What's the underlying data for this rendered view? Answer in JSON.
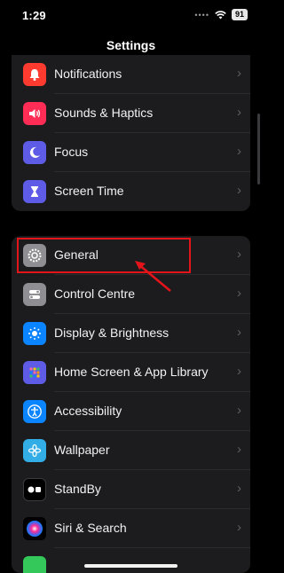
{
  "status": {
    "time": "1:29",
    "battery": "91"
  },
  "header": {
    "title": "Settings"
  },
  "group1": [
    {
      "label": "Notifications",
      "icon": "bell-icon",
      "color": "#ff3b30"
    },
    {
      "label": "Sounds & Haptics",
      "icon": "speaker-icon",
      "color": "#ff2d55"
    },
    {
      "label": "Focus",
      "icon": "moon-icon",
      "color": "#5e5ce6"
    },
    {
      "label": "Screen Time",
      "icon": "hourglass-icon",
      "color": "#5e5ce6"
    }
  ],
  "group2": [
    {
      "label": "General",
      "icon": "gear-icon",
      "color": "#8e8e93"
    },
    {
      "label": "Control Centre",
      "icon": "toggles-icon",
      "color": "#8e8e93"
    },
    {
      "label": "Display & Brightness",
      "icon": "sun-icon",
      "color": "#0a84ff"
    },
    {
      "label": "Home Screen & App Library",
      "icon": "grid-icon",
      "color": "#5e5ce6"
    },
    {
      "label": "Accessibility",
      "icon": "accessibility-icon",
      "color": "#0a84ff"
    },
    {
      "label": "Wallpaper",
      "icon": "flower-icon",
      "color": "#32ade6"
    },
    {
      "label": "StandBy",
      "icon": "standby-icon",
      "color": "#1c1c1e"
    },
    {
      "label": "Siri & Search",
      "icon": "siri-icon",
      "color": "#2c2c2e"
    }
  ],
  "annotation": {
    "highlight_color": "#e3151b"
  }
}
